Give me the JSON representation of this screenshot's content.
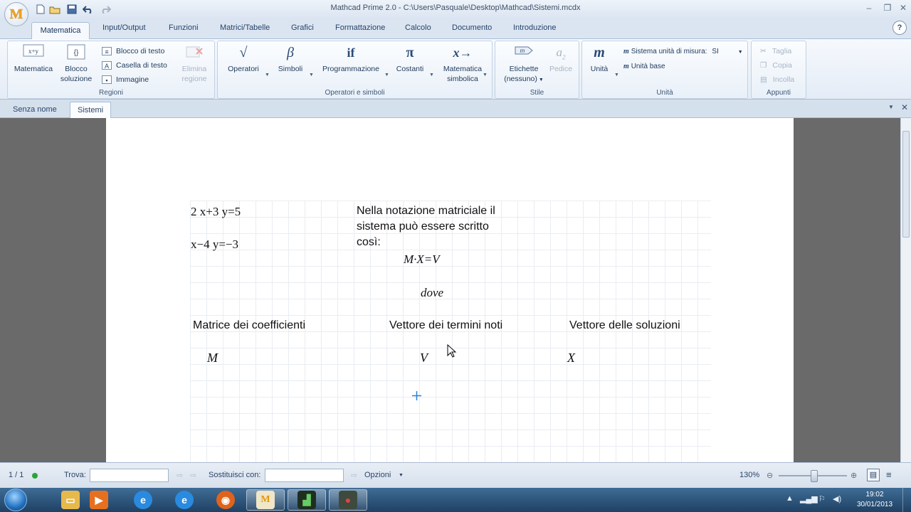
{
  "window": {
    "title": "Mathcad Prime 2.0 - C:\\Users\\Pasquale\\Desktop\\Mathcad\\Sistemi.mcdx"
  },
  "ribbon_tabs": [
    "Matematica",
    "Input/Output",
    "Funzioni",
    "Matrici/Tabelle",
    "Grafici",
    "Formattazione",
    "Calcolo",
    "Documento",
    "Introduzione"
  ],
  "regioni": {
    "label": "Regioni",
    "matematica": "Matematica",
    "blocco_soluzione": [
      "Blocco",
      "soluzione"
    ],
    "blocco_di_testo": "Blocco di testo",
    "casella_di_testo": "Casella di testo",
    "immagine": "Immagine",
    "elimina_regione": [
      "Elimina",
      "regione"
    ]
  },
  "operatori_simboli": {
    "label": "Operatori e simboli",
    "operatori": "Operatori",
    "simboli": "Simboli",
    "programmazione": "Programmazione",
    "costanti": "Costanti",
    "matematica_simbolica": [
      "Matematica",
      "simbolica"
    ]
  },
  "stile": {
    "label": "Stile",
    "etichette": [
      "Etichette",
      "(nessuno)"
    ],
    "pedice": "Pedice"
  },
  "unita": {
    "label": "Unità",
    "unita_btn": "Unità",
    "sistema": "Sistema unità di misura:",
    "sistema_value": "SI",
    "unita_base": "Unità base"
  },
  "appunti": {
    "label": "Appunti",
    "taglia": "Taglia",
    "copia": "Copia",
    "incolla": "Incolla"
  },
  "doc_tabs": [
    "Senza nome",
    "Sistemi"
  ],
  "worksheet": {
    "eq1": "2 x+3 y=5",
    "eq2": "x−4 y=−3",
    "note_lines": [
      "Nella notazione matriciale il",
      "sistema può essere scritto",
      "così:"
    ],
    "matrix_eq": "M·X=V",
    "dove": "dove",
    "label_M": "Matrice dei coefficienti",
    "label_V": "Vettore dei termini noti",
    "label_X": "Vettore delle soluzioni",
    "var_M": "M",
    "var_V": "V",
    "var_X": "X"
  },
  "statusbar": {
    "page": "1 / 1",
    "trova": "Trova:",
    "sostituisci": "Sostituisci con:",
    "opzioni": "Opzioni",
    "zoom": "130%",
    "zoom_level_fraction": 0.52
  },
  "taskbar": {
    "time": "19:02",
    "date": "30/01/2013",
    "apps": [
      "explorer-icon",
      "media-player-icon",
      "ie-icon",
      "ie-icon",
      "firefox-icon",
      "mathcad-icon",
      "terminal-icon",
      "app-icon"
    ]
  },
  "colors": {
    "grid_line": "#e9edf2",
    "workspace_bg": "#6a6a6a",
    "cursor_blue": "#2b7fd6",
    "accent": "#1e395b"
  }
}
